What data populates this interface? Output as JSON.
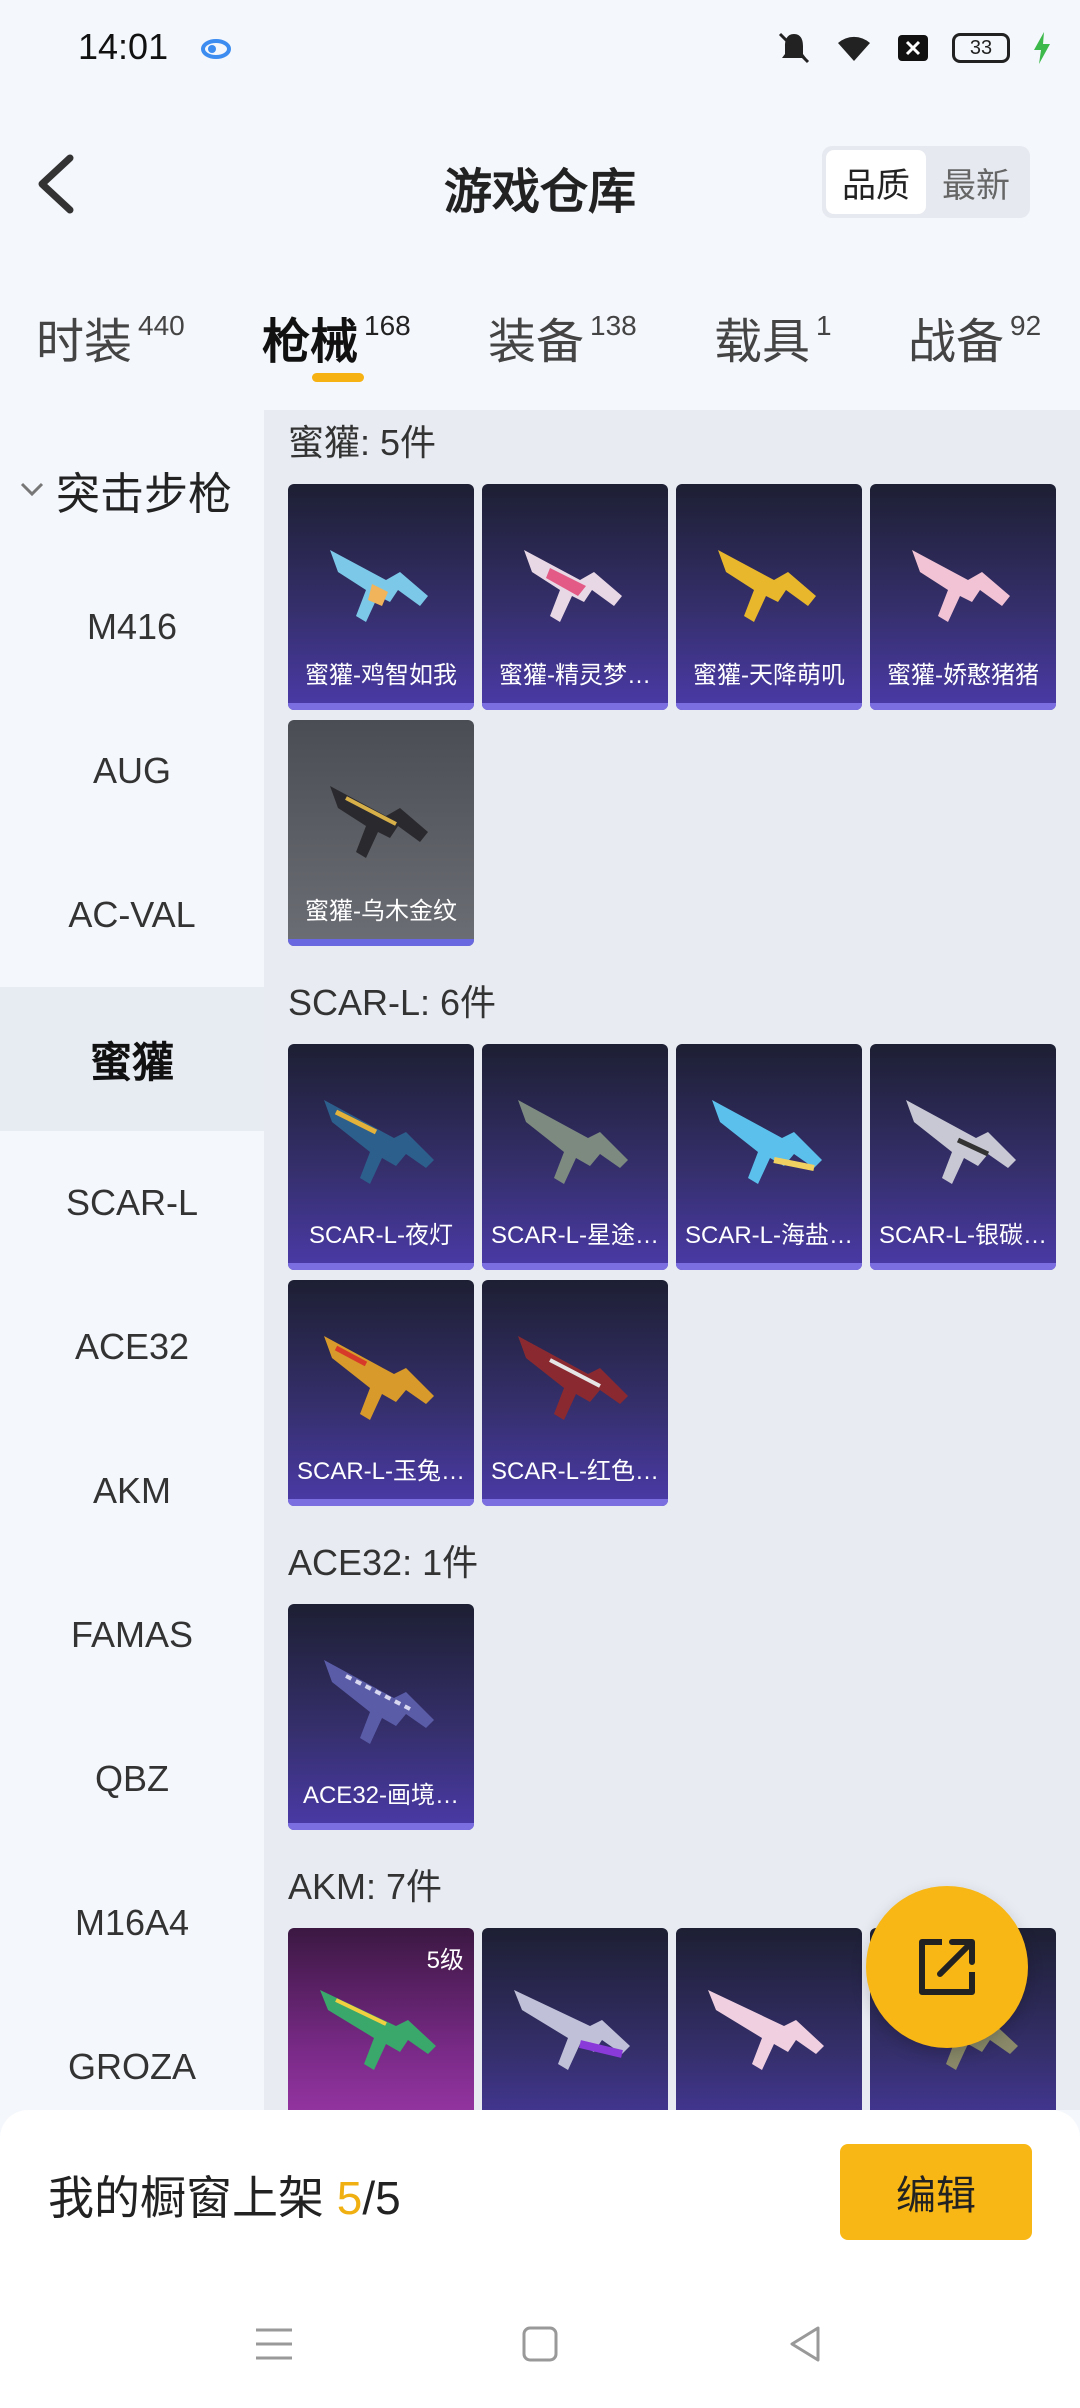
{
  "status": {
    "time": "14:01",
    "battery": "33"
  },
  "header": {
    "title": "游戏仓库",
    "sort_quality": "品质",
    "sort_newest": "最新"
  },
  "tabs": [
    {
      "label": "时装",
      "count": "440"
    },
    {
      "label": "枪械",
      "count": "168"
    },
    {
      "label": "装备",
      "count": "138"
    },
    {
      "label": "载具",
      "count": "1"
    },
    {
      "label": "战备",
      "count": "92"
    }
  ],
  "sidebar": {
    "heading": "突击步枪",
    "items": [
      "M416",
      "AUG",
      "AC-VAL",
      "蜜獾",
      "SCAR-L",
      "ACE32",
      "AKM",
      "FAMAS",
      "QBZ",
      "M16A4",
      "GROZA"
    ]
  },
  "groups": [
    {
      "title": "蜜獾: 5件",
      "items": [
        "蜜獾-鸡智如我",
        "蜜獾-精灵梦…",
        "蜜獾-天降萌叽",
        "蜜獾-娇憨猪猪",
        "蜜獾-乌木金纹"
      ]
    },
    {
      "title": "SCAR-L: 6件",
      "items": [
        "SCAR-L-夜灯",
        "SCAR-L-星途…",
        "SCAR-L-海盐…",
        "SCAR-L-银碳…",
        "SCAR-L-玉兔…",
        "SCAR-L-红色…"
      ]
    },
    {
      "title": "ACE32: 1件",
      "items": [
        "ACE32-画境…"
      ]
    },
    {
      "title": "AKM: 7件",
      "level_badge": "5级"
    }
  ],
  "bottom": {
    "shelf_prefix": "我的橱窗上架 ",
    "shelf_current": "5",
    "shelf_total": "/5",
    "edit_label": "编辑"
  },
  "colors": {
    "accent": "#f8b714",
    "card_purple": "#4a3aa8",
    "card_gray": "#5f6168",
    "card_magenta": "#a43bb0"
  },
  "icons": {
    "back": "chevron-left-icon",
    "fab": "share-external-icon",
    "cloud": "cloud-sync-icon"
  }
}
